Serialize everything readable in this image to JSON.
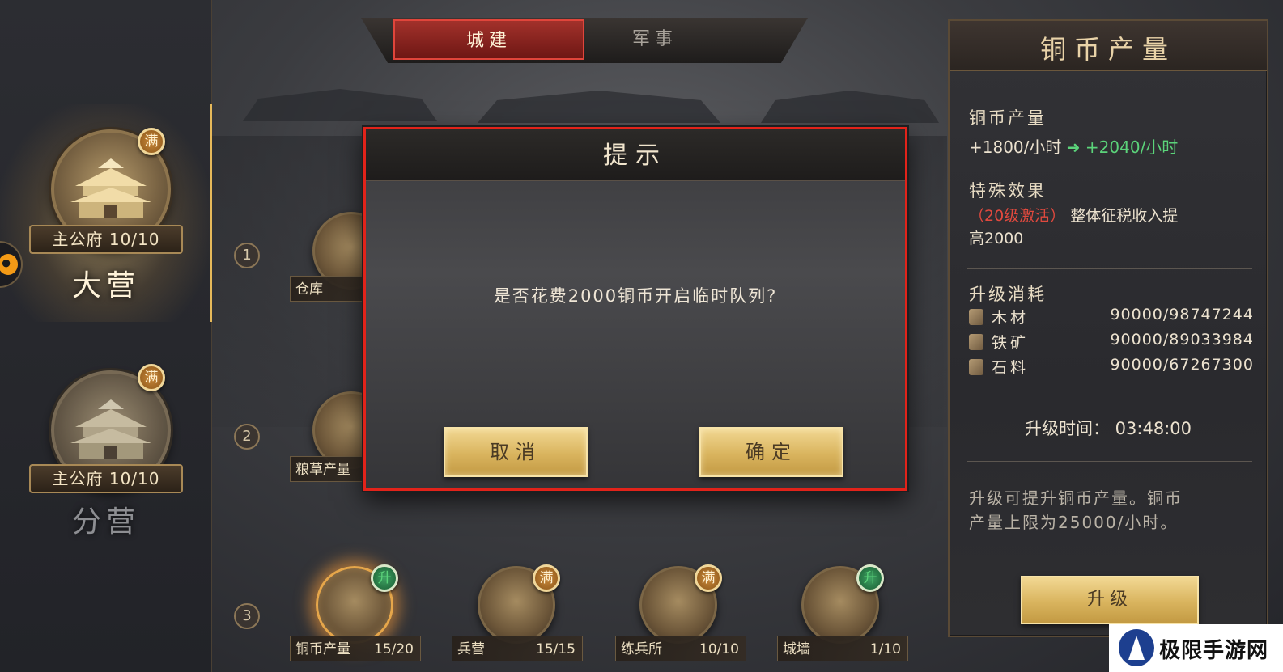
{
  "top_tabs": {
    "city": "城建",
    "military": "军事",
    "active": "city"
  },
  "camps": [
    {
      "level_label": "主公府 10/10",
      "name": "大营",
      "badge": "满",
      "selected": true
    },
    {
      "level_label": "主公府 10/10",
      "name": "分营",
      "badge": "满",
      "selected": false
    }
  ],
  "rows": [
    {
      "num": "1",
      "buildings": [
        {
          "name": "仓库",
          "level": ""
        }
      ]
    },
    {
      "num": "2",
      "buildings": [
        {
          "name": "粮草产量",
          "level": ""
        }
      ]
    },
    {
      "num": "3",
      "buildings": [
        {
          "name": "铜币产量",
          "level": "15/20",
          "badge": "升",
          "badge_color": "green",
          "icon": "coins-icon"
        },
        {
          "name": "兵营",
          "level": "15/15",
          "badge": "满",
          "badge_color": "orange",
          "icon": "drum-icon"
        },
        {
          "name": "练兵所",
          "level": "10/10",
          "badge": "满",
          "badge_color": "orange",
          "icon": "gate-icon"
        },
        {
          "name": "城墙",
          "level": "1/10",
          "badge": "升",
          "badge_color": "green",
          "icon": "wall-icon"
        }
      ]
    }
  ],
  "dialog": {
    "title": "提示",
    "message": "是否花费2000铜币开启临时队列?",
    "cancel": "取消",
    "confirm": "确定"
  },
  "panel": {
    "title": "铜币产量",
    "production_label": "铜币产量",
    "production_current": "+1800/小时",
    "production_next": "+2040/小时",
    "special_label": "特殊效果",
    "special_activate": "（20级激活）",
    "special_desc_1": "整体征税收入提",
    "special_desc_2": "高2000",
    "cost_label": "升级消耗",
    "costs": [
      {
        "name": "木材",
        "amount": "90000/98747244",
        "icon": "wood-icon"
      },
      {
        "name": "铁矿",
        "amount": "90000/89033984",
        "icon": "iron-icon"
      },
      {
        "name": "石料",
        "amount": "90000/67267300",
        "icon": "stone-icon"
      }
    ],
    "time_label": "升级时间：",
    "time_value": "03:48:00",
    "desc_1": "升级可提升铜币产量。铜币",
    "desc_2": "产量上限为25000/小时。",
    "upgrade": "升级"
  },
  "watermark": {
    "text": "极限手游网"
  }
}
